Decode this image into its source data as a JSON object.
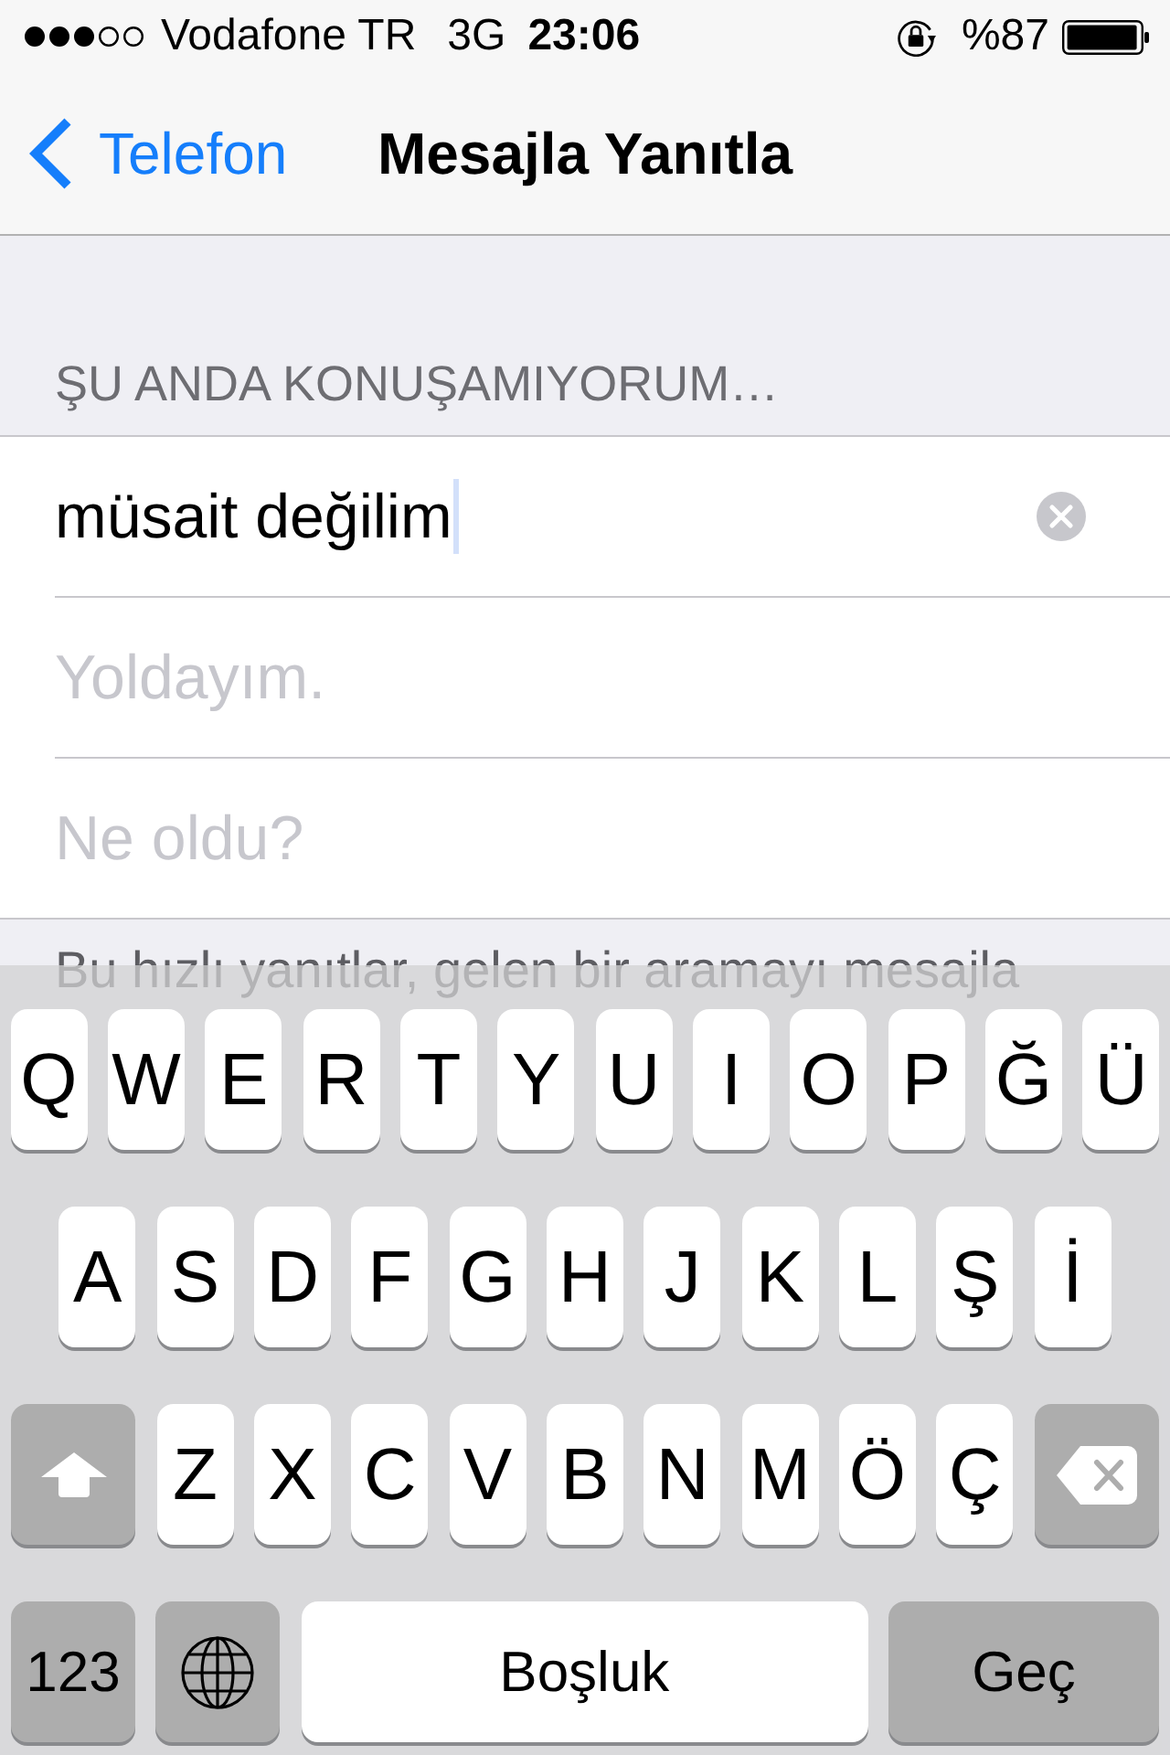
{
  "status_bar": {
    "carrier": "Vodafone TR",
    "network": "3G",
    "time": "23:06",
    "battery": "%87"
  },
  "nav_bar": {
    "back": "Telefon",
    "title": "Mesajla Yanıtla"
  },
  "section": {
    "header": "ŞU ANDA KONUŞAMIYORUM…",
    "rows": [
      {
        "value": "müsait değilim",
        "focused": true
      },
      {
        "placeholder": "Yoldayım.",
        "focused": false
      },
      {
        "placeholder": "Ne oldu?",
        "focused": false
      }
    ],
    "footer": "Bu hızlı yanıtlar, gelen bir aramayı mesajla"
  },
  "keyboard": {
    "key_rows": [
      {
        "keys": [
          {
            "kind": "letter",
            "label": "Q"
          },
          {
            "kind": "letter",
            "label": "W"
          },
          {
            "kind": "letter",
            "label": "E"
          },
          {
            "kind": "letter",
            "label": "R"
          },
          {
            "kind": "letter",
            "label": "T"
          },
          {
            "kind": "letter",
            "label": "Y"
          },
          {
            "kind": "letter",
            "label": "U"
          },
          {
            "kind": "letter",
            "label": "I"
          },
          {
            "kind": "letter",
            "label": "O"
          },
          {
            "kind": "letter",
            "label": "P"
          },
          {
            "kind": "letter",
            "label": "Ğ"
          },
          {
            "kind": "letter",
            "label": "Ü"
          }
        ]
      },
      {
        "keys": [
          {
            "kind": "letter",
            "label": "A"
          },
          {
            "kind": "letter",
            "label": "S"
          },
          {
            "kind": "letter",
            "label": "D"
          },
          {
            "kind": "letter",
            "label": "F"
          },
          {
            "kind": "letter",
            "label": "G"
          },
          {
            "kind": "letter",
            "label": "H"
          },
          {
            "kind": "letter",
            "label": "J"
          },
          {
            "kind": "letter",
            "label": "K"
          },
          {
            "kind": "letter",
            "label": "L"
          },
          {
            "kind": "letter",
            "label": "Ş"
          },
          {
            "kind": "letter",
            "label": "İ"
          }
        ]
      },
      {
        "keys": [
          {
            "kind": "shift"
          },
          {
            "kind": "letter",
            "label": "Z"
          },
          {
            "kind": "letter",
            "label": "X"
          },
          {
            "kind": "letter",
            "label": "C"
          },
          {
            "kind": "letter",
            "label": "V"
          },
          {
            "kind": "letter",
            "label": "B"
          },
          {
            "kind": "letter",
            "label": "N"
          },
          {
            "kind": "letter",
            "label": "M"
          },
          {
            "kind": "letter",
            "label": "Ö"
          },
          {
            "kind": "letter",
            "label": "Ç"
          },
          {
            "kind": "backspace"
          }
        ]
      },
      {
        "keys": [
          {
            "kind": "mode",
            "label": "123"
          },
          {
            "kind": "globe"
          },
          {
            "kind": "space",
            "label": "Boşluk"
          },
          {
            "kind": "return",
            "label": "Geç"
          }
        ]
      }
    ]
  }
}
